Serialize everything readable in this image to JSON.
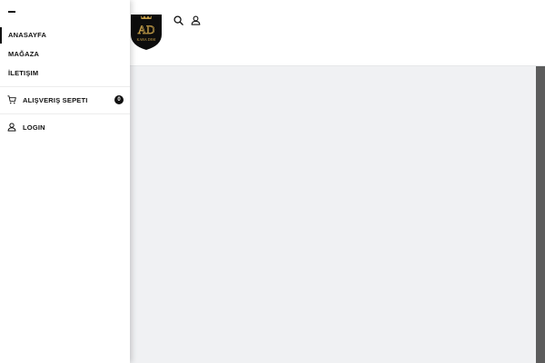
{
  "menu": {
    "items": [
      {
        "label": "ANASAYFA",
        "active": true
      },
      {
        "label": "MAĞAZA",
        "active": false
      },
      {
        "label": "İLETIŞIM",
        "active": false
      }
    ],
    "cart": {
      "label": "ALIŞVERIŞ SEPETI",
      "count": "0",
      "icon": "shopping-cart-icon"
    },
    "login": {
      "label": "LOGIN",
      "icon": "user-icon"
    },
    "close_icon": "close-menu-icon"
  },
  "header": {
    "logo_text": "KARA DESI",
    "logo_monogram": "AD",
    "icons": [
      "search-icon",
      "user-icon"
    ]
  },
  "colors": {
    "text": "#111111",
    "content_bg": "#f0f1f3",
    "scrollbar": "#5c5c5c",
    "logo_gold": "#c9a24a",
    "logo_black": "#0d0d0d"
  }
}
